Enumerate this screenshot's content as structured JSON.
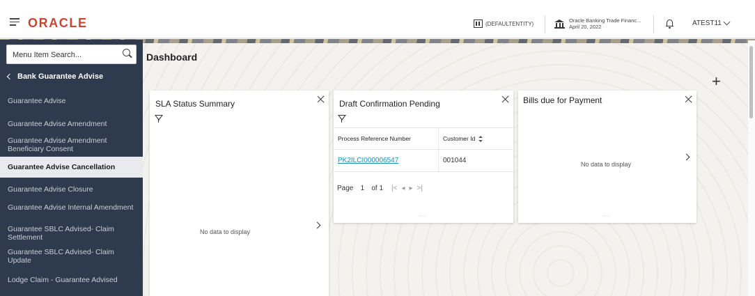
{
  "header": {
    "logo": "ORACLE",
    "entity": "(DEFAULTENTITY)",
    "bank_name": "Oracle Banking Trade Financ...",
    "bank_date": "April 20, 2022",
    "user": "ATEST11"
  },
  "sidebar": {
    "search_placeholder": "Menu Item Search...",
    "section_title": "Bank Guarantee Advise",
    "items": [
      {
        "label": "Guarantee Advise"
      },
      {
        "label": "Guarantee Advise Amendment"
      },
      {
        "label": "Guarantee Advise Amendment Beneficiary Consent"
      },
      {
        "label": "Guarantee Advise Cancellation"
      },
      {
        "label": "Guarantee Advise Closure"
      },
      {
        "label": "Guarantee Advise Internal Amendment"
      },
      {
        "label": "Guarantee SBLC Advised- Claim Settlement"
      },
      {
        "label": "Guarantee SBLC Advised- Claim Update"
      },
      {
        "label": "Lodge Claim - Guarantee Advised"
      }
    ]
  },
  "main": {
    "page_title": "Dashboard",
    "add_label": "+"
  },
  "widgets": {
    "sla": {
      "title": "SLA Status Summary",
      "no_data": "No data to display"
    },
    "draft": {
      "title": "Draft Confirmation Pending",
      "columns": [
        "Process Reference Number",
        "Customer Id"
      ],
      "rows": [
        {
          "ref": "PK2ILCI000006547",
          "customer": "001044"
        }
      ],
      "pager": {
        "page_label": "Page",
        "page": "1",
        "of_label": "of 1"
      }
    },
    "bills": {
      "title": "Bills due for Payment",
      "no_data": "No data to display"
    }
  }
}
